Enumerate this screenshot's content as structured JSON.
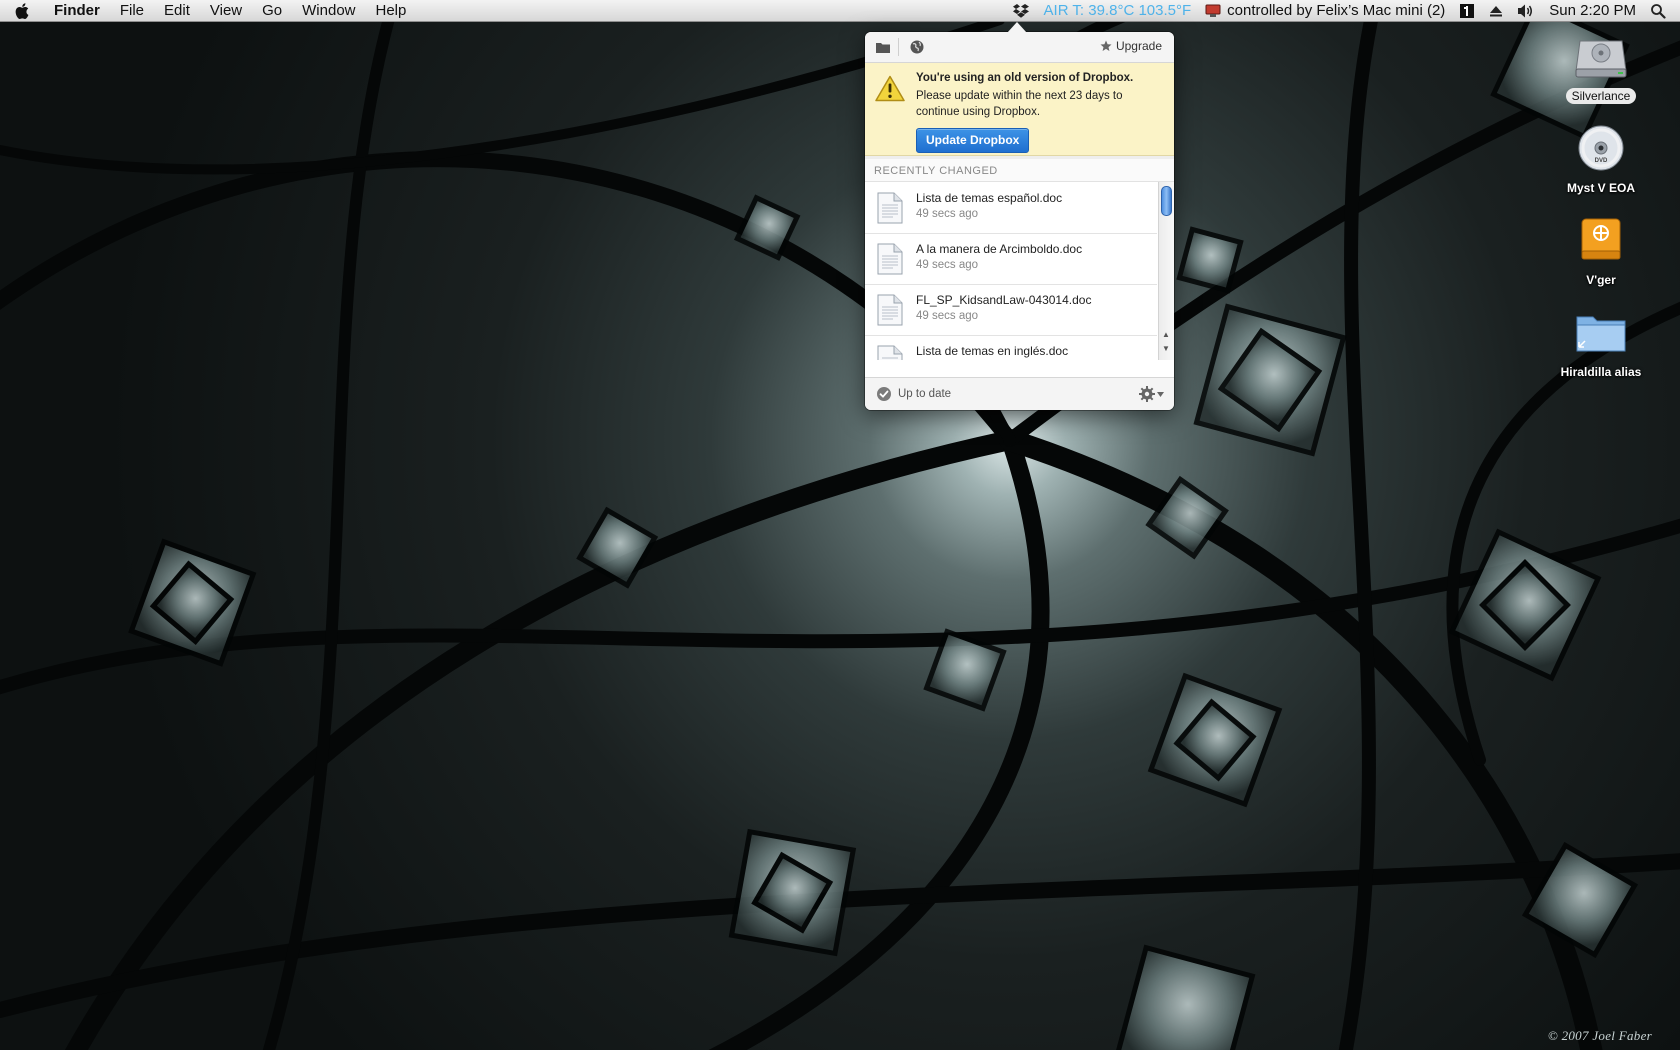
{
  "menubar": {
    "app_name": "Finder",
    "menus": [
      "File",
      "Edit",
      "View",
      "Go",
      "Window",
      "Help"
    ],
    "air_temp": "AIR T: 39.8°C  103.5°F",
    "controlled_by": "controlled by Felix’s Mac mini (2)",
    "clock": "Sun 2:20 PM"
  },
  "dropbox": {
    "upgrade_label": "Upgrade",
    "alert_title": "You're using an old version of Dropbox.",
    "alert_body": "Please update within the next 23 days to continue using Dropbox.",
    "update_button": "Update Dropbox",
    "recent_header": "RECENTLY CHANGED",
    "files": [
      {
        "name": "Lista de temas español.doc",
        "time": "49 secs ago"
      },
      {
        "name": "A la manera de Arcimboldo.doc",
        "time": "49 secs ago"
      },
      {
        "name": "FL_SP_KidsandLaw-043014.doc",
        "time": "49 secs ago"
      },
      {
        "name": "Lista de temas en inglés.doc",
        "time": ""
      }
    ],
    "status": "Up to date"
  },
  "desktop": {
    "icons": [
      {
        "label": "Silverlance",
        "icon": "hard-drive-icon",
        "selected": true
      },
      {
        "label": "Myst V EOA",
        "icon": "dvd-icon",
        "selected": false
      },
      {
        "label": "V'ger",
        "icon": "external-drive-icon",
        "selected": false
      },
      {
        "label": "Hiraldilla alias",
        "icon": "folder-icon",
        "selected": false
      }
    ],
    "credit": "© 2007 Joel Faber"
  },
  "colors": {
    "air_temp": "#4fb3ea",
    "update_button": "#2a7fdc",
    "alert_bg": "#fbf3c7"
  }
}
